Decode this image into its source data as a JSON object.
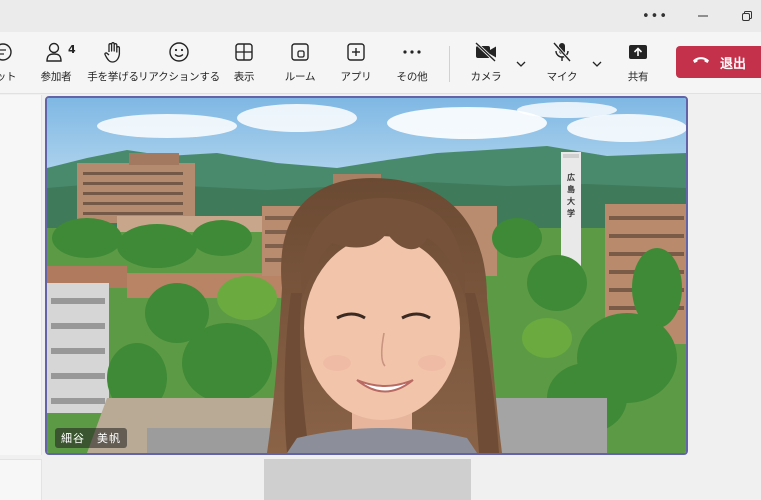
{
  "window": {
    "more_icon": "more-horizontal-icon",
    "minimize_icon": "minimize-icon",
    "restore_icon": "restore-icon"
  },
  "toolbar": {
    "items": [
      {
        "label": "ット",
        "icon": "chat-icon"
      },
      {
        "label": "参加者",
        "icon": "people-icon",
        "badge": "4"
      },
      {
        "label": "手を挙げる",
        "icon": "raise-hand-icon"
      },
      {
        "label": "リアクションする",
        "icon": "smile-icon"
      },
      {
        "label": "表示",
        "icon": "grid-view-icon"
      },
      {
        "label": "ルーム",
        "icon": "rooms-icon"
      },
      {
        "label": "アプリ",
        "icon": "add-app-icon"
      },
      {
        "label": "その他",
        "icon": "more-icon"
      },
      {
        "label": "カメラ",
        "icon": "camera-off-icon"
      },
      {
        "label": "マイク",
        "icon": "mic-off-icon"
      },
      {
        "label": "共有",
        "icon": "share-screen-icon"
      }
    ],
    "leave_label": "退出",
    "leave_color": "#c4314b"
  },
  "stage": {
    "participant_name": "細谷　美帆",
    "tile_border_color": "#6264a7",
    "tower_sign": "広島大学"
  }
}
